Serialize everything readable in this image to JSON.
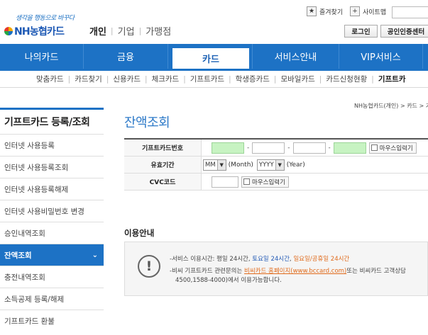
{
  "header": {
    "slogan": "생각을 행동으로 바꾸다",
    "logo_text": "NH농협카드",
    "segments": [
      "개인",
      "기업",
      "가맹점"
    ],
    "utility": {
      "bookmark_label": "즐겨찾기",
      "sitemap_label": "사이트맵",
      "login_label": "로그인",
      "cert_label": "공인인증센터"
    }
  },
  "gnb": {
    "items": [
      {
        "label": "나의카드"
      },
      {
        "label": "금융"
      },
      {
        "label": "카드"
      },
      {
        "label": "서비스안내"
      },
      {
        "label": "VIP서비스"
      }
    ]
  },
  "lnb": {
    "items": [
      {
        "label": "맞춤카드"
      },
      {
        "label": "카드찾기"
      },
      {
        "label": "신용카드"
      },
      {
        "label": "체크카드"
      },
      {
        "label": "기프트카드"
      },
      {
        "label": "학생증카드"
      },
      {
        "label": "모바일카드"
      },
      {
        "label": "카드신청현황"
      },
      {
        "label": "기프트카"
      }
    ]
  },
  "sidebar": {
    "title": "기프트카드 등록/조회",
    "items": [
      {
        "label": "인터넷 사용등록"
      },
      {
        "label": "인터넷 사용등록조회"
      },
      {
        "label": "인터넷 사용등록해제"
      },
      {
        "label": "인터넷 사용비밀번호 변경"
      },
      {
        "label": "승인내역조회"
      },
      {
        "label": "잔액조회"
      },
      {
        "label": "충전내역조회"
      },
      {
        "label": "소득공제 등록/해제"
      },
      {
        "label": "기프트카드 환불"
      }
    ]
  },
  "breadcrumb": "NH농협카드(개인) > 카드 > 기",
  "page_title": "잔액조회",
  "form": {
    "card_number_label": "기프트카드번호",
    "mouse_input_label": "마우스입력기",
    "expiry_label": "유효기간",
    "month_value": "MM",
    "month_unit": "(Month)",
    "year_value": "YYYY",
    "year_unit": "(Year)",
    "cvc_label": "CVC코드"
  },
  "info": {
    "title": "이용안내",
    "line1_prefix": "-서비스 이용시간: 평일 24시간, ",
    "line1_sat": "토요일 24시간",
    "line1_sep": ", ",
    "line1_holiday": "일요일/공휴일 24시간",
    "line2_prefix": "-비씨 기프트카드 관련문의는 ",
    "line2_link": "비씨카드 홈페이지(www.bccard.com)",
    "line2_suffix": "또는 비씨카드 고객상담",
    "line3": "4500,1588-4000)에서 이용가능합니다."
  },
  "colors": {
    "brand_blue": "#1d72c5",
    "title_blue": "#2c79c8",
    "input_green": "#c7f3c2",
    "accent_orange": "#e06a1b"
  }
}
